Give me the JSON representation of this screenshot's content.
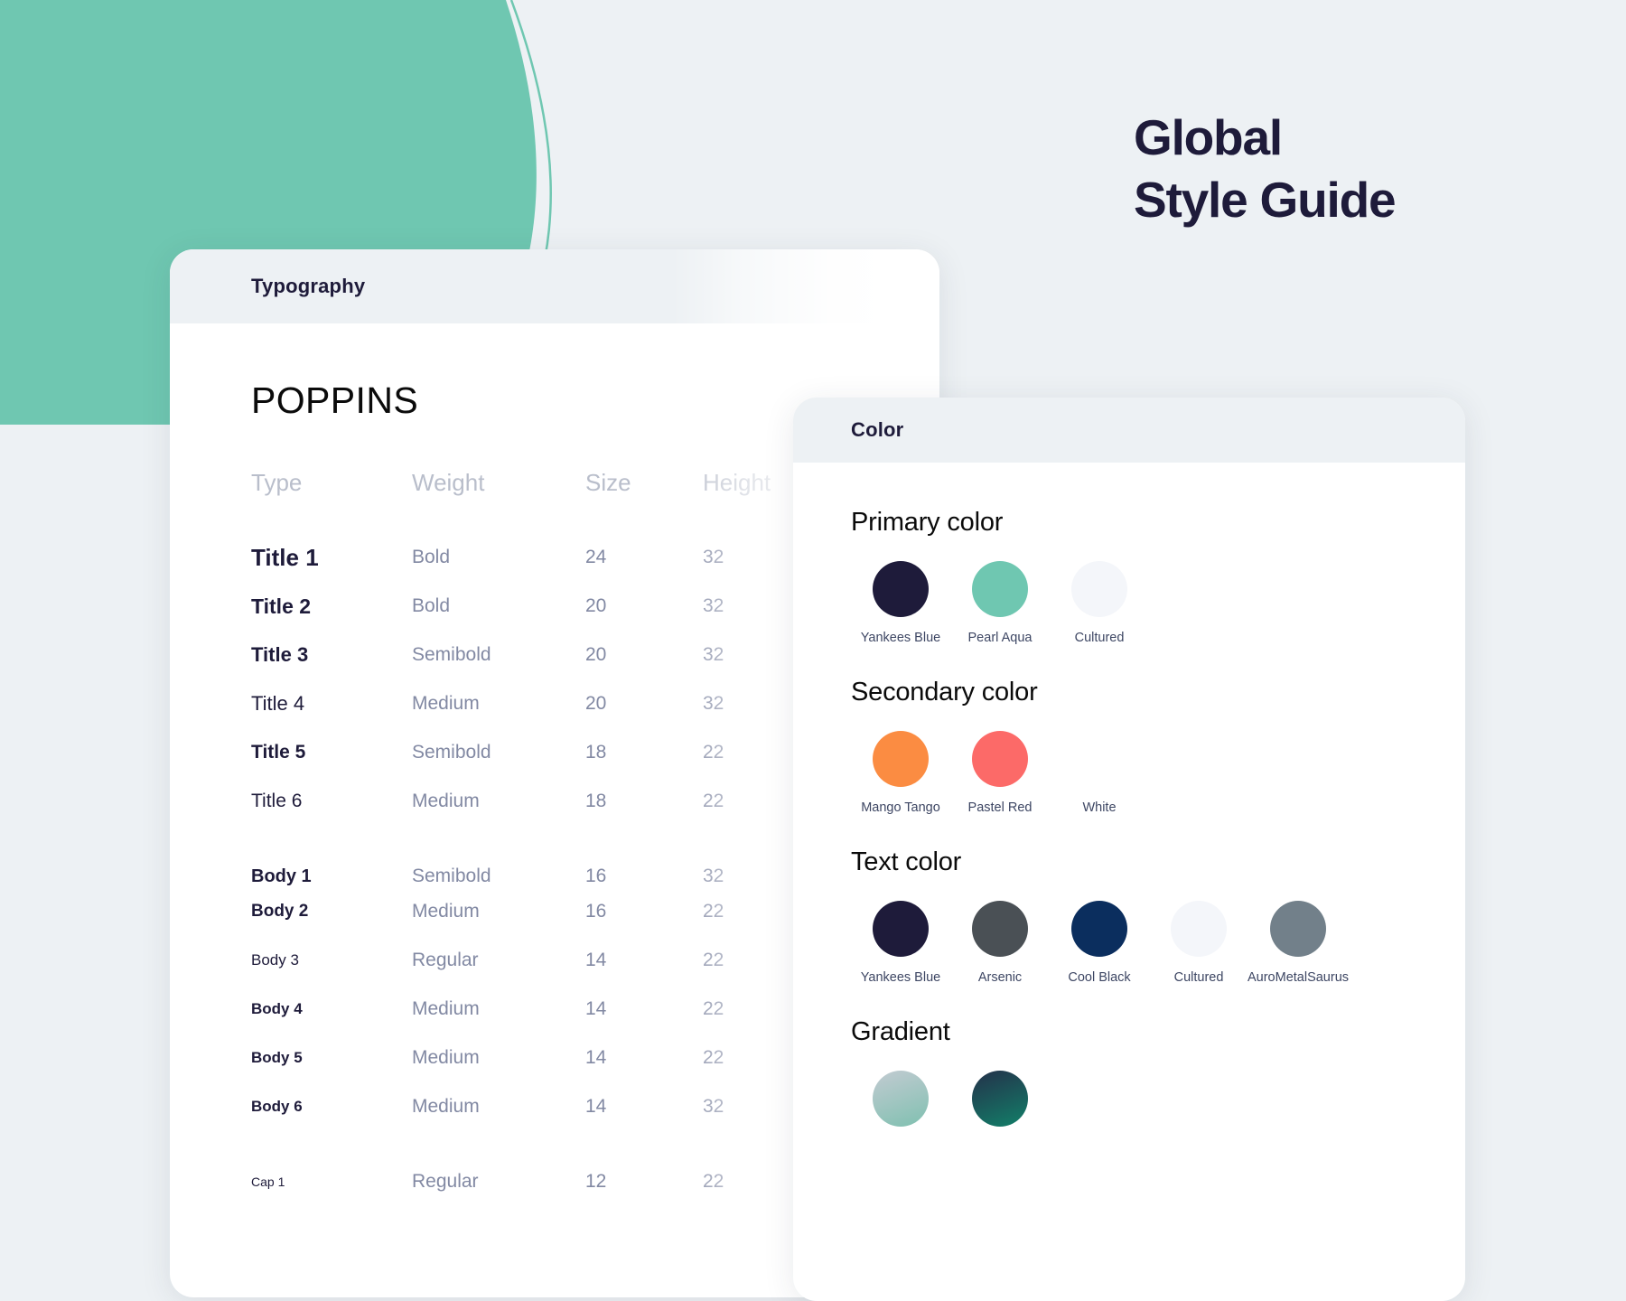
{
  "page": {
    "title_lines": [
      "Global",
      "Style Guide"
    ],
    "background_color": "#EDF1F4",
    "accent_color": "#6FC7B1",
    "title_color": "#1E1B3A"
  },
  "typography_card": {
    "header_title": "Typography",
    "font_name": "POPPINS",
    "columns": [
      "Type",
      "Weight",
      "Size",
      "Height"
    ],
    "rows": [
      {
        "type": "Title 1",
        "weight": "Bold",
        "size": "24",
        "height": "32"
      },
      {
        "type": "Title 2",
        "weight": "Bold",
        "size": "20",
        "height": "32"
      },
      {
        "type": "Title 3",
        "weight": "Semibold",
        "size": "20",
        "height": "32"
      },
      {
        "type": "Title 4",
        "weight": "Medium",
        "size": "20",
        "height": "32"
      },
      {
        "type": "Title 5",
        "weight": "Semibold",
        "size": "18",
        "height": "22"
      },
      {
        "type": "Title 6",
        "weight": "Medium",
        "size": "18",
        "height": "22"
      },
      {
        "type": "Body 1",
        "weight": "Semibold",
        "size": "16",
        "height": "32"
      },
      {
        "type": "Body 2",
        "weight": "Medium",
        "size": "16",
        "height": "22"
      },
      {
        "type": "Body 3",
        "weight": "Regular",
        "size": "14",
        "height": "22"
      },
      {
        "type": "Body 4",
        "weight": "Medium",
        "size": "14",
        "height": "22"
      },
      {
        "type": "Body 5",
        "weight": "Medium",
        "size": "14",
        "height": "22"
      },
      {
        "type": "Body 6",
        "weight": "Medium",
        "size": "14",
        "height": "32"
      },
      {
        "type": "Cap 1",
        "weight": "Regular",
        "size": "12",
        "height": "22"
      }
    ]
  },
  "color_card": {
    "header_title": "Color",
    "sections": [
      {
        "title": "Primary color",
        "swatches": [
          {
            "label": "Yankees Blue",
            "color": "#1E1B3A"
          },
          {
            "label": "Pearl Aqua",
            "color": "#6FC7B1"
          },
          {
            "label": "Cultured",
            "color": "#F4F6FA"
          }
        ]
      },
      {
        "title": "Secondary color",
        "swatches": [
          {
            "label": "Mango Tango",
            "color": "#FB8C42"
          },
          {
            "label": "Pastel Red",
            "color": "#FC6A68"
          },
          {
            "label": "White",
            "color": "#FFFFFF"
          }
        ]
      },
      {
        "title": "Text color",
        "swatches": [
          {
            "label": "Yankees Blue",
            "color": "#1E1B3A"
          },
          {
            "label": "Arsenic",
            "color": "#4A5055"
          },
          {
            "label": "Cool Black",
            "color": "#0B2E5E"
          },
          {
            "label": "Cultured",
            "color": "#F4F6FA"
          },
          {
            "label": "AuroMetalSaurus",
            "color": "#72808A"
          }
        ]
      },
      {
        "title": "Gradient",
        "swatches": [
          {
            "label": "",
            "color": "linear-gradient(160deg, #C3CBD2 0%, #7FC0B0 100%)"
          },
          {
            "label": "",
            "color": "linear-gradient(160deg, #24304A 0%, #128069 100%)"
          }
        ]
      }
    ]
  }
}
